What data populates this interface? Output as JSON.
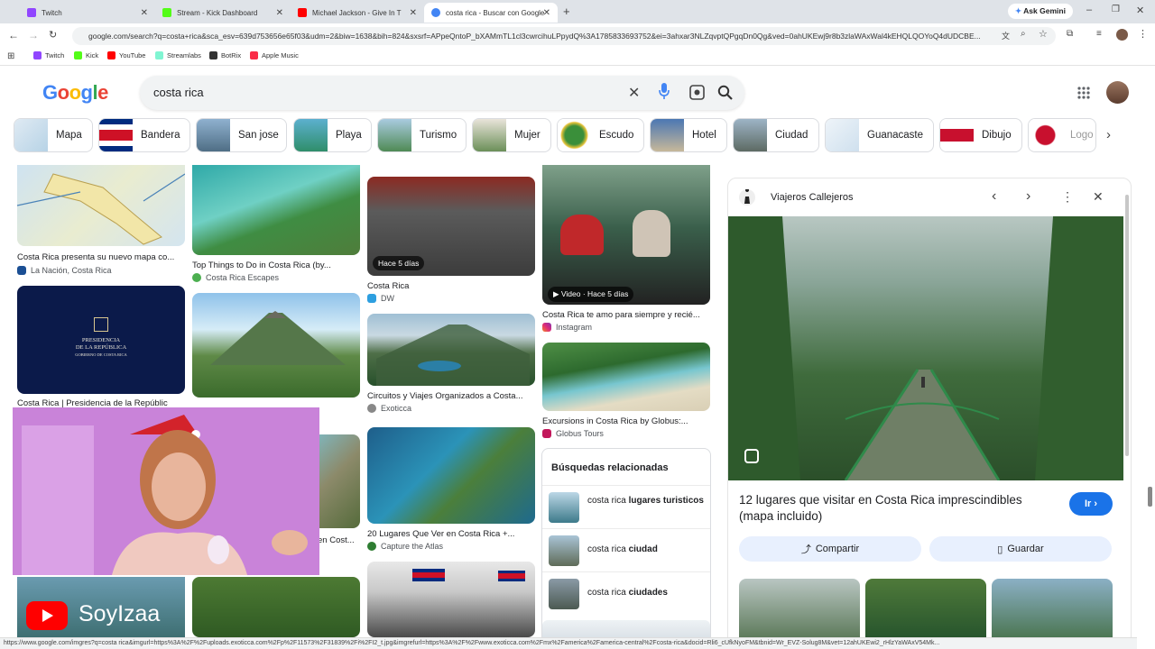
{
  "tabs": [
    {
      "label": "Twitch",
      "color": "#9146ff"
    },
    {
      "label": "Stream - Kick Dashboard",
      "color": "#53fc18"
    },
    {
      "label": "Michael Jackson - Give In T",
      "color": "#ff0000"
    },
    {
      "label": "costa rica - Buscar con Google",
      "color": "#4285f4"
    }
  ],
  "toolbar": {
    "ask_gemini": "Ask Gemini"
  },
  "address": {
    "url": "google.com/search?q=costa+rica&sca_esv=639d753656e65f03&udm=2&biw=1638&bih=824&sxsrf=APpeQntoP_bXAMmTL1cl3cwrcihuLPpydQ%3A1785833693752&ei=3ahxar3NLZqvptQPgqDn0Qg&ved=0ahUKEwj9r8b3zlaWAxWal4kEHQLQOYoQ4dUDCBE..."
  },
  "bookmarks": [
    {
      "label": "Twitch",
      "color": "#9146ff"
    },
    {
      "label": "Kick",
      "color": "#53fc18"
    },
    {
      "label": "YouTube",
      "color": "#ff0000"
    },
    {
      "label": "Streamlabs",
      "color": "#80f5d2"
    },
    {
      "label": "BotRix",
      "color": "#333333"
    },
    {
      "label": "Apple Music",
      "color": "#fa2d48"
    }
  ],
  "search": {
    "query": "costa rica"
  },
  "chips": [
    {
      "label": "Mapa",
      "color": "#b7d3e6"
    },
    {
      "label": "Bandera",
      "color": "#c8102e"
    },
    {
      "label": "San jose",
      "color": "#6e8ea8"
    },
    {
      "label": "Playa",
      "color": "#3a9bb8"
    },
    {
      "label": "Turismo",
      "color": "#6aa37a"
    },
    {
      "label": "Mujer",
      "color": "#8a6a55"
    },
    {
      "label": "Escudo",
      "color": "#2f6fb0"
    },
    {
      "label": "Hotel",
      "color": "#446a9a"
    },
    {
      "label": "Ciudad",
      "color": "#7b8c94"
    },
    {
      "label": "Guanacaste",
      "color": "#cfe0ee"
    },
    {
      "label": "Dibujo",
      "color": "#c8102e"
    },
    {
      "label": "Logo",
      "color": "#c8102e"
    }
  ],
  "results": {
    "col1": [
      {
        "title": "Costa Rica presenta su nuevo mapa co...",
        "source": "La Nación, Costa Rica"
      },
      {
        "title": "Costa Rica | Presidencia de la Repúblic",
        "source": ""
      },
      {
        "logo_top": "PRESIDENCIA",
        "logo_mid": "DE LA REPÚBLICA",
        "logo_bottom": "GOBIERNO DE COSTA RICA"
      }
    ],
    "col2": [
      {
        "title": "Top Things to Do in Costa Rica (by...",
        "source": "Costa Rica Escapes"
      },
      {
        "title": "en Cost...",
        "source": ""
      }
    ],
    "col3": [
      {
        "title": "Costa Rica",
        "source": "DW",
        "badge": "Hace 5 días"
      },
      {
        "title": "Circuitos y Viajes Organizados a Costa...",
        "source": "Exoticca"
      },
      {
        "title": "20 Lugares Que Ver en Costa Rica +...",
        "source": "Capture the Atlas"
      }
    ],
    "col4": [
      {
        "title": "Costa Rica te amo para siempre y recié...",
        "source": "Instagram",
        "badge": "Video · Hace 5 días"
      },
      {
        "title": "Excursions in Costa Rica by Globus:...",
        "source": "Globus Tours"
      }
    ]
  },
  "related": {
    "heading": "Búsquedas relacionadas",
    "items": [
      {
        "prefix": "costa rica",
        "bold": "lugares turisticos"
      },
      {
        "prefix": "costa rica",
        "bold": "ciudad"
      },
      {
        "prefix": "costa rica",
        "bold": "ciudades"
      }
    ]
  },
  "panel": {
    "site": "Viajeros Callejeros",
    "title": "12 lugares que visitar en Costa Rica imprescindibles (mapa incluido)",
    "visit": "Ir",
    "share": "Compartir",
    "save": "Guardar"
  },
  "overlay": {
    "channel": "SoyIzaa"
  },
  "statusbar": "https://www.google.com/imgres?q=costa rica&imgurl=https%3A%2F%2Fuploads.exoticca.com%2Fp%2F11573%2F31839%2Fi%2FI2_t.jpg&imgrefurl=https%3A%2F%2Fwww.exoticca.com%2Fmx%2Famerica%2Famerica-central%2Fcosta-rica&docid=Rli6_cUfkNyoFM&tbnid=Wr_EVZ-Solug8M&vet=12ahUKEwi2_rHlzYaWAxV54Mk..."
}
